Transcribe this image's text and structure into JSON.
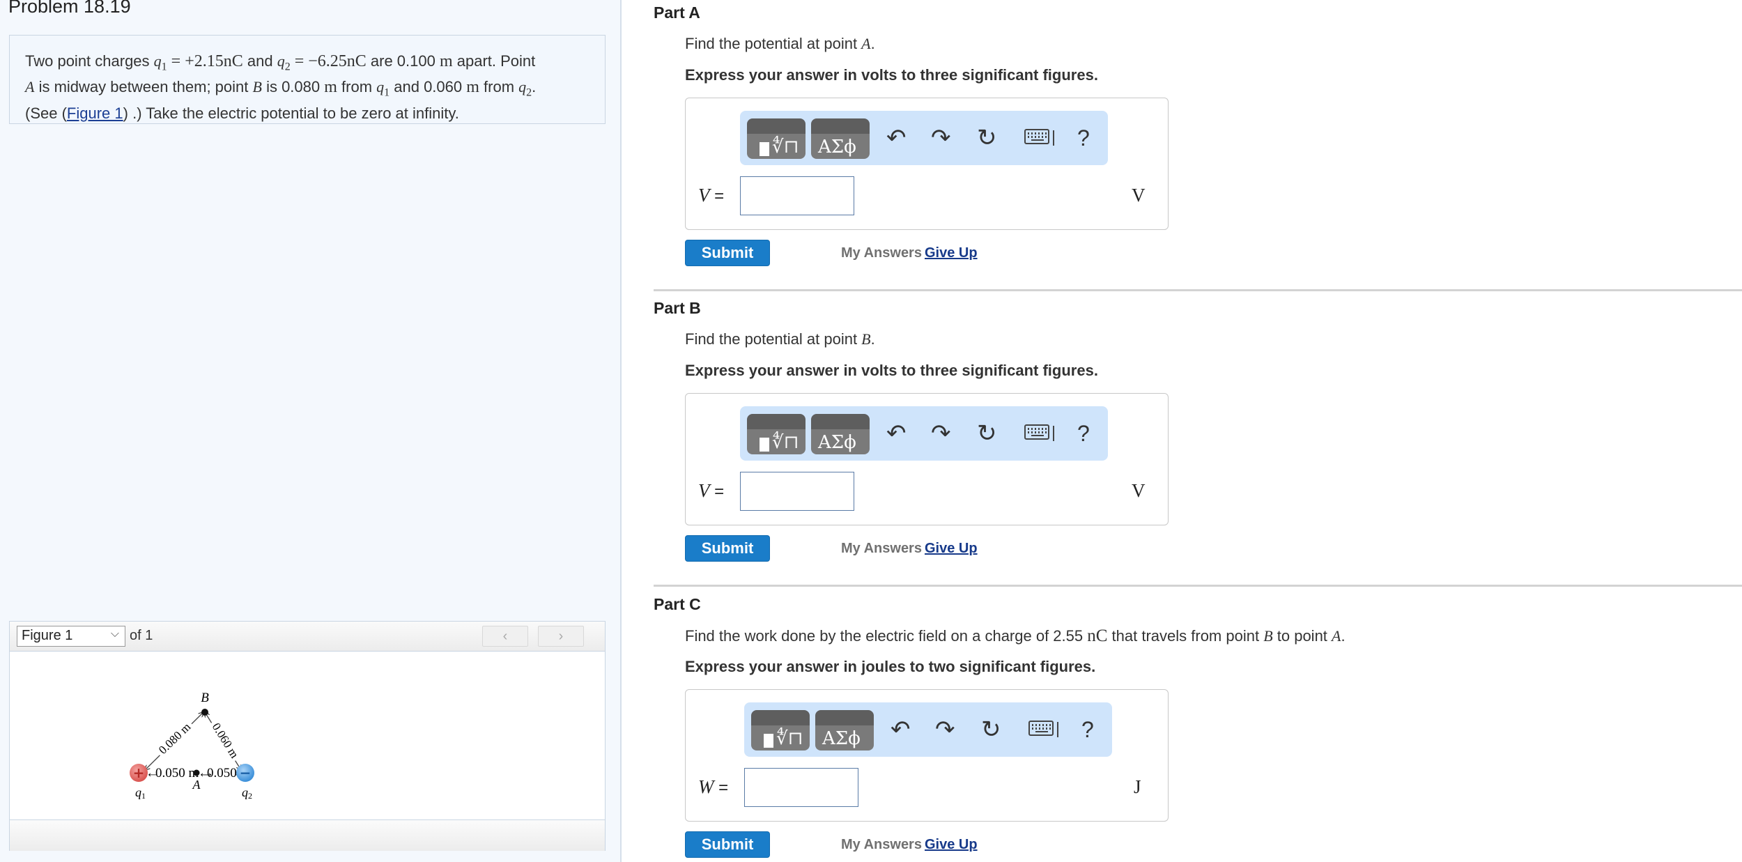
{
  "problem": {
    "title": "Problem 18.19",
    "statement": {
      "t1": "Two point charges ",
      "q1_sym": "q",
      "q1_sub": "1",
      "q1_val": " = +2.15nC",
      "t2": " and ",
      "q2_sym": "q",
      "q2_sub": "2",
      "q2_val": " = −6.25nC",
      "t3": " are 0.100 ",
      "unit_m": "m",
      "t4": " apart. Point ",
      "pointA": "A",
      "t5": " is midway between them; point ",
      "pointB": "B",
      "t6": " is 0.080 ",
      "t7": " from ",
      "t8": " and 0.060 ",
      "t9": ".",
      "t10": "(See (",
      "figure_link": "Figure 1",
      "t11": ") .) Take the electric potential to be zero at infinity."
    }
  },
  "figure": {
    "select_value": "Figure 1",
    "of_label": "of 1",
    "prev_label": "‹",
    "next_label": "›",
    "labels": {
      "B": "B",
      "A": "A",
      "q1": "q",
      "q1_sub": "1",
      "q2": "q",
      "q2_sub": "2",
      "d_q1_B": "0.080 m",
      "d_q2_B": "0.060 m",
      "d_q1_A": "0.050 m",
      "d_A_q2": "0.050 m",
      "plus": "+",
      "minus": "−"
    },
    "colors": {
      "positive": "#d9534f",
      "negative": "#3a8fd9"
    }
  },
  "toolbar": {
    "templates_icon": "templates-icon",
    "greek_label": "ΑΣϕ",
    "radical_label": "∜⊓",
    "undo_icon": "↶",
    "redo_icon": "↷",
    "reset_icon": "↻",
    "help_label": "?"
  },
  "parts": [
    {
      "title": "Part A",
      "q_text": "Find the potential at point ",
      "q_var": "A",
      "q_end": ".",
      "instruction": "Express your answer in volts to three significant figures.",
      "answer_var": "V",
      "answer_eq": " =",
      "answer_value": "",
      "unit": "V",
      "submit": "Submit",
      "my_answers": "My Answers",
      "give_up": "Give Up"
    },
    {
      "title": "Part B",
      "q_text": "Find the potential at point ",
      "q_var": "B",
      "q_end": ".",
      "instruction": "Express your answer in volts to three significant figures.",
      "answer_var": "V",
      "answer_eq": " =",
      "answer_value": "",
      "unit": "V",
      "submit": "Submit",
      "my_answers": "My Answers",
      "give_up": "Give Up"
    },
    {
      "title": "Part C",
      "q_text": "Find the work done by the electric field on a charge of 2.55 ",
      "q_unit": "nC",
      "q_text2": " that travels from point ",
      "q_var": "B",
      "q_text3": " to point ",
      "q_var2": "A",
      "q_end": ".",
      "instruction": "Express your answer in joules to two significant figures.",
      "answer_var": "W",
      "answer_eq": " =",
      "answer_value": "",
      "unit": "J",
      "submit": "Submit",
      "my_answers": "My Answers",
      "give_up": "Give Up"
    }
  ],
  "colors": {
    "submit": "#1a7dc9",
    "link": "#173a8a",
    "toolbar_bg": "#cfe4fb",
    "left_bg": "#f4f8fd"
  }
}
